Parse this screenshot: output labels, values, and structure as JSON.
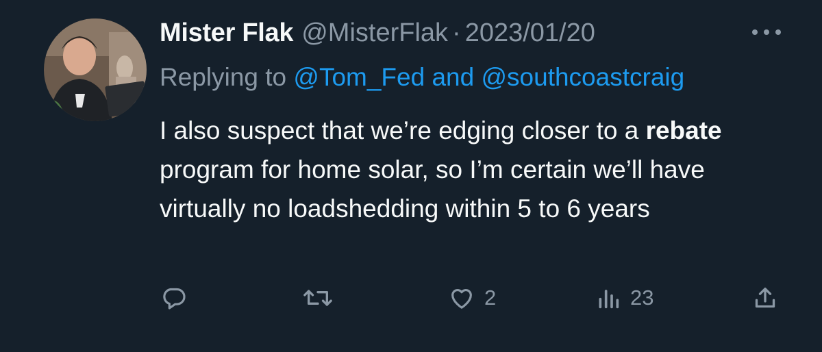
{
  "tweet": {
    "author_name": "Mister Flak",
    "handle": "@MisterFlak",
    "separator": "·",
    "date": "2023/01/20",
    "replying_prefix": "Replying to",
    "reply_mention_1": "@Tom_Fed",
    "reply_conjunction": "and",
    "reply_mention_2": "@southcoastcraig",
    "body_intro": "I also suspect that we’re edging closer to a",
    "body_bold": "rebate",
    "body_rest": "program for home solar, so I’m certain we’ll have virtually no loadshedding within 5 to 6 years"
  },
  "actions": {
    "reply_icon": "reply-icon",
    "retweet_icon": "retweet-icon",
    "like_icon": "heart-icon",
    "like_count": "2",
    "views_icon": "views-icon",
    "views_count": "23",
    "share_icon": "share-icon",
    "more_icon": "more-icon"
  },
  "colors": {
    "background": "#15202b",
    "text_primary": "#f7f9f9",
    "text_secondary": "#8b98a5",
    "link": "#1d9bf0"
  }
}
